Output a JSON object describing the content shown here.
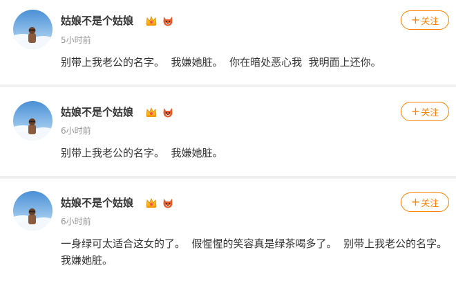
{
  "posts": [
    {
      "username": "姑娘不是个姑娘",
      "time": "5小时前",
      "follow_label": "关注",
      "follow_plus": "+",
      "text": "别带上我老公的名字。  我嫌她脏。  你在暗处恶心我  我明面上还你。"
    },
    {
      "username": "姑娘不是个姑娘",
      "time": "6小时前",
      "follow_label": "关注",
      "follow_plus": "+",
      "text": "别带上我老公的名字。  我嫌她脏。"
    },
    {
      "username": "姑娘不是个姑娘",
      "time": "6小时前",
      "follow_label": "关注",
      "follow_plus": "+",
      "text": "一身绿可太适合这女的了。  假惺惺的笑容真是绿茶喝多了。  别带上我老公的名字。  我嫌她脏。"
    }
  ],
  "colors": {
    "accent": "#ff8200",
    "name": "#333333",
    "meta": "#939393",
    "separator": "#f0f0f0"
  },
  "icons": [
    "crown-badge-icon",
    "fox-badge-icon"
  ]
}
